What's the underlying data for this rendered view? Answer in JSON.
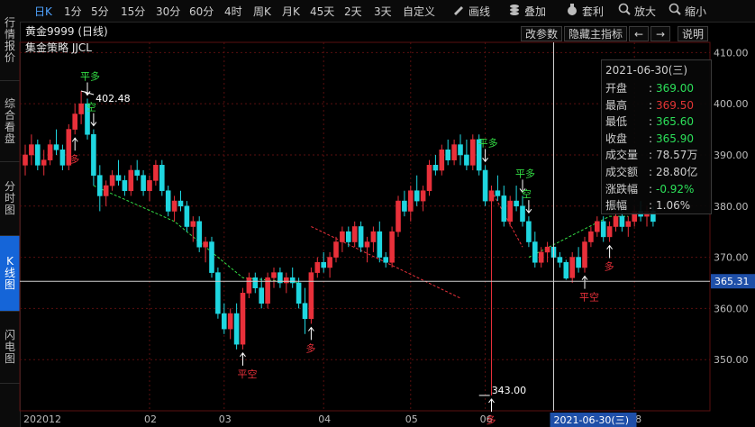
{
  "left_nav": [
    {
      "label": "行情报价",
      "active": false
    },
    {
      "label": "综合看盘",
      "active": false
    },
    {
      "label": "分时图",
      "active": false
    },
    {
      "label": "K线图",
      "active": true
    },
    {
      "label": "闪电图",
      "active": false
    }
  ],
  "toolbar": {
    "periods": [
      "日K",
      "1分",
      "5分",
      "15分",
      "30分",
      "60分",
      "4时",
      "周K",
      "月K",
      "45天",
      "2天",
      "3天",
      "自定义"
    ],
    "active_period": "日K",
    "tools": [
      {
        "label": "画线",
        "icon": "draw-line-icon"
      },
      {
        "label": "叠加",
        "icon": "overlay-icon"
      },
      {
        "label": "套利",
        "icon": "arbitrage-icon"
      },
      {
        "label": "放大",
        "icon": "zoom-in-icon"
      },
      {
        "label": "缩小",
        "icon": "zoom-out-icon"
      }
    ]
  },
  "header": {
    "title": "黄金9999 (日线)",
    "strategy": "集金策略 JJCL",
    "buttons": [
      "改参数",
      "隐藏主指标",
      "←",
      "→",
      "说明"
    ]
  },
  "info_panel": {
    "date": "2021-06-30(三)",
    "rows": [
      {
        "label": "开盘",
        "value": "369.00",
        "color": "#2ce05a"
      },
      {
        "label": "最高",
        "value": "369.50",
        "color": "#e23535"
      },
      {
        "label": "最低",
        "value": "365.60",
        "color": "#2ce05a"
      },
      {
        "label": "收盘",
        "value": "365.90",
        "color": "#2ce05a"
      },
      {
        "label": "成交量",
        "value": "78.57万",
        "color": "#cfcfcf"
      },
      {
        "label": "成交额",
        "value": "28.80亿",
        "color": "#cfcfcf"
      },
      {
        "label": "涨跌幅",
        "value": "-0.92%",
        "color": "#2ce05a"
      },
      {
        "label": "振幅",
        "value": "1.06%",
        "color": "#cfcfcf"
      }
    ]
  },
  "colors": {
    "up": "#e8303a",
    "down": "#1fd6e0",
    "grid": "#5a0f0f",
    "signal_buy": "#e8303a",
    "signal_sell": "#33dd44"
  },
  "chart_data": {
    "type": "candlestick",
    "ylim": [
      340,
      412
    ],
    "y_ticks": [
      "410.00",
      "400.00",
      "390.00",
      "380.00",
      "370.00",
      "360.00",
      "350.00"
    ],
    "x_labels": [
      "202012",
      "02",
      "03",
      "04",
      "05",
      "06",
      "08"
    ],
    "crosshair_value": "365.31",
    "crosshair_date": "2021-06-30(三)",
    "high_label": "402.48",
    "low_label": "343.00",
    "candles": [
      [
        388,
        392,
        386,
        390
      ],
      [
        390,
        394,
        388,
        392
      ],
      [
        392,
        393,
        387,
        388
      ],
      [
        388,
        391,
        386,
        389
      ],
      [
        389,
        393,
        388,
        392
      ],
      [
        392,
        395,
        390,
        391
      ],
      [
        391,
        392,
        387,
        388
      ],
      [
        388,
        396,
        387,
        395
      ],
      [
        395,
        400,
        394,
        398
      ],
      [
        398,
        402.5,
        396,
        400
      ],
      [
        400,
        401,
        393,
        394
      ],
      [
        394,
        395,
        384,
        386
      ],
      [
        386,
        388,
        379,
        382
      ],
      [
        382,
        385,
        380,
        384
      ],
      [
        384,
        387,
        383,
        386
      ],
      [
        386,
        389,
        384,
        385
      ],
      [
        385,
        386,
        382,
        383
      ],
      [
        383,
        388,
        382,
        387
      ],
      [
        387,
        389,
        385,
        386
      ],
      [
        386,
        387,
        382,
        383
      ],
      [
        383,
        386,
        381,
        385
      ],
      [
        385,
        389,
        384,
        388
      ],
      [
        388,
        389,
        382,
        383
      ],
      [
        383,
        384,
        378,
        379
      ],
      [
        379,
        382,
        377,
        381
      ],
      [
        381,
        383,
        379,
        380
      ],
      [
        380,
        381,
        375,
        376
      ],
      [
        376,
        378,
        373,
        377
      ],
      [
        377,
        378,
        371,
        372
      ],
      [
        372,
        374,
        369,
        373
      ],
      [
        373,
        374,
        366,
        367
      ],
      [
        367,
        368,
        358,
        359
      ],
      [
        359,
        361,
        355,
        356
      ],
      [
        356,
        360,
        354,
        359
      ],
      [
        359,
        361,
        352,
        353
      ],
      [
        353,
        364,
        352,
        363
      ],
      [
        363,
        367,
        362,
        366
      ],
      [
        366,
        367,
        363,
        364
      ],
      [
        364,
        366,
        360,
        361
      ],
      [
        361,
        367,
        360,
        366
      ],
      [
        366,
        368,
        364,
        367
      ],
      [
        367,
        368,
        364,
        365
      ],
      [
        365,
        367,
        363,
        366
      ],
      [
        366,
        368,
        364,
        365
      ],
      [
        365,
        366,
        360,
        361
      ],
      [
        361,
        364,
        355,
        358
      ],
      [
        358,
        368,
        357,
        367
      ],
      [
        367,
        370,
        366,
        369
      ],
      [
        369,
        371,
        367,
        368
      ],
      [
        368,
        371,
        366,
        370
      ],
      [
        370,
        374,
        369,
        373
      ],
      [
        373,
        376,
        371,
        375
      ],
      [
        375,
        376,
        372,
        373
      ],
      [
        373,
        377,
        372,
        376
      ],
      [
        376,
        377,
        371,
        372
      ],
      [
        372,
        374,
        369,
        373
      ],
      [
        373,
        376,
        371,
        375
      ],
      [
        375,
        377,
        369,
        370
      ],
      [
        370,
        371,
        368,
        369
      ],
      [
        369,
        376,
        368,
        375
      ],
      [
        375,
        382,
        374,
        381
      ],
      [
        381,
        383,
        378,
        379
      ],
      [
        379,
        384,
        377,
        383
      ],
      [
        383,
        386,
        380,
        381
      ],
      [
        381,
        384,
        379,
        383
      ],
      [
        383,
        389,
        382,
        388
      ],
      [
        388,
        390,
        386,
        387
      ],
      [
        387,
        392,
        386,
        391
      ],
      [
        391,
        393,
        388,
        389
      ],
      [
        389,
        393,
        388,
        392
      ],
      [
        392,
        394,
        388,
        390
      ],
      [
        390,
        393,
        387,
        388
      ],
      [
        388,
        394,
        387,
        393
      ],
      [
        393,
        394,
        386,
        387
      ],
      [
        387,
        388,
        380,
        381
      ],
      [
        381,
        384,
        343,
        383
      ],
      [
        383,
        386,
        381,
        382
      ],
      [
        382,
        384,
        376,
        377
      ],
      [
        377,
        382,
        376,
        381
      ],
      [
        381,
        384,
        379,
        380
      ],
      [
        380,
        382,
        376,
        377
      ],
      [
        377,
        378,
        372,
        373
      ],
      [
        373,
        375,
        368,
        369
      ],
      [
        369,
        372,
        368,
        371
      ],
      [
        371,
        373,
        369,
        372
      ],
      [
        372,
        373,
        369,
        370
      ],
      [
        370,
        371,
        368,
        369
      ],
      [
        369,
        369.5,
        365.6,
        365.9
      ],
      [
        366,
        371,
        365,
        370
      ],
      [
        370,
        372,
        367,
        368
      ],
      [
        368,
        374,
        367,
        373
      ],
      [
        373,
        376,
        372,
        375
      ],
      [
        375,
        378,
        374,
        377
      ],
      [
        377,
        378,
        373,
        374
      ],
      [
        374,
        377,
        373,
        376
      ],
      [
        376,
        379,
        375,
        378
      ],
      [
        378,
        379,
        375,
        376
      ],
      [
        376,
        378,
        374,
        377
      ],
      [
        377,
        380,
        376,
        379
      ],
      [
        379,
        381,
        377,
        378
      ],
      [
        378,
        380,
        376,
        379
      ],
      [
        379,
        380,
        376,
        377
      ]
    ],
    "signals": [
      {
        "text": "多",
        "index": 8,
        "type": "buy"
      },
      {
        "text": "平多",
        "index": 10,
        "type": "sell"
      },
      {
        "text": "空",
        "index": 11,
        "type": "sell"
      },
      {
        "text": "平空",
        "index": 35,
        "type": "buy"
      },
      {
        "text": "多",
        "index": 46,
        "type": "buy"
      },
      {
        "text": "平多",
        "index": 74,
        "type": "sell"
      },
      {
        "text": "多",
        "index": 75,
        "type": "buy"
      },
      {
        "text": "平多",
        "index": 80,
        "type": "sell"
      },
      {
        "text": "空",
        "index": 81,
        "type": "sell"
      },
      {
        "text": "平空",
        "index": 90,
        "type": "buy"
      },
      {
        "text": "多",
        "index": 94,
        "type": "buy"
      }
    ]
  }
}
